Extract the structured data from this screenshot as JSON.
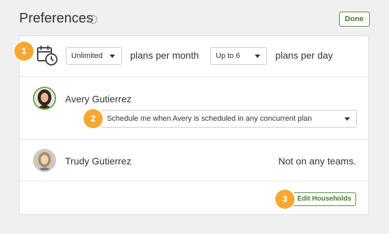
{
  "header": {
    "title": "Preferences",
    "info_glyph": "i",
    "done_label": "Done"
  },
  "scheduling": {
    "badge": "1",
    "plans_per_month": {
      "value": "Unlimited"
    },
    "plans_per_month_label": "plans per month",
    "plans_per_day": {
      "value": "Up to 6"
    },
    "plans_per_day_label": "plans per day"
  },
  "household": [
    {
      "name": "Avery Gutierrez",
      "badge": "2",
      "schedule_option": {
        "value": "Schedule me when Avery is scheduled in any concurrent plan"
      }
    },
    {
      "name": "Trudy Gutierrez",
      "teams_status": "Not on any teams."
    }
  ],
  "footer": {
    "badge": "3",
    "edit_households_label": "Edit Households"
  },
  "colors": {
    "accent_green": "#4a7a2e",
    "badge_orange": "#f7a832",
    "background": "#f0f0f0"
  },
  "icons": [
    "info-icon",
    "calendar-clock-icon",
    "chevron-down-icon",
    "avatar"
  ]
}
